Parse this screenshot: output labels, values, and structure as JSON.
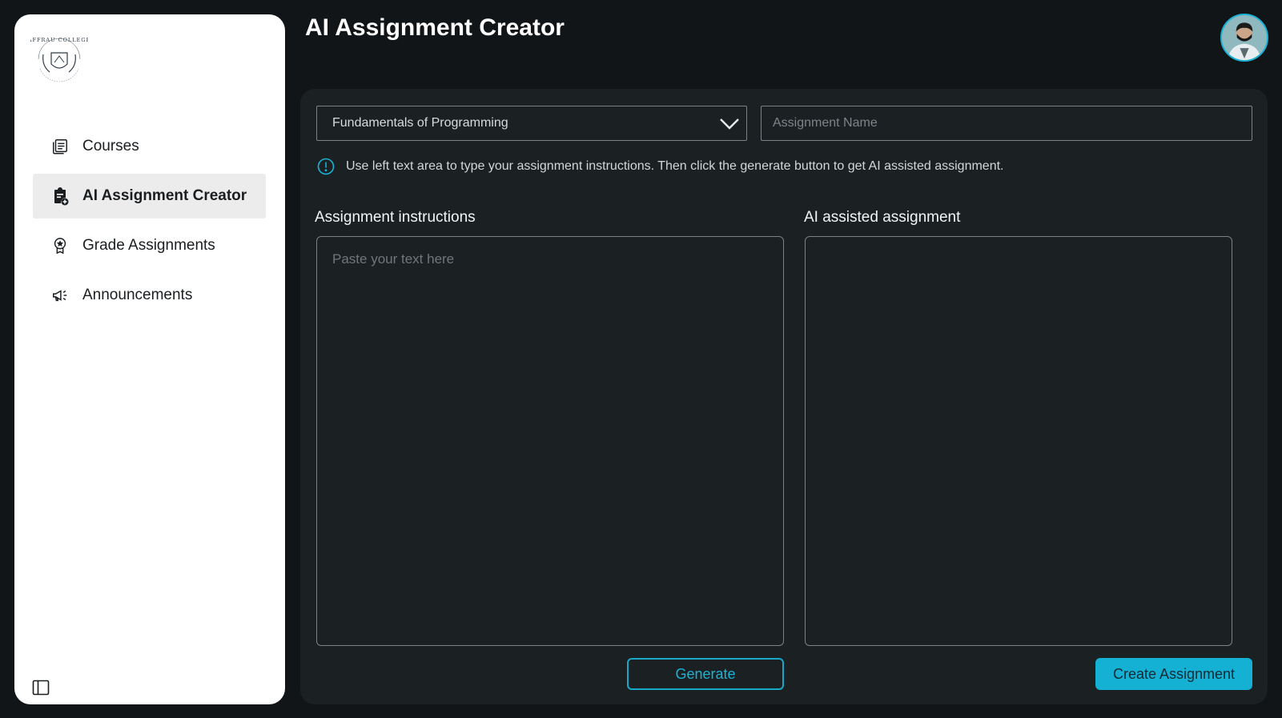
{
  "app": {
    "page_title": "AI Assignment Creator",
    "logo_text": "AFFRAU COLLEGE"
  },
  "sidebar": {
    "items": [
      {
        "label": "Courses",
        "icon": "courses-icon",
        "active": false
      },
      {
        "label": "AI Assignment Creator",
        "icon": "clipboard-plus-icon",
        "active": true
      },
      {
        "label": "Grade Assignments",
        "icon": "award-badge-icon",
        "active": false
      },
      {
        "label": "Announcements",
        "icon": "megaphone-icon",
        "active": false
      }
    ]
  },
  "form": {
    "course_selected": "Fundamentals of Programming",
    "assignment_name_placeholder": "Assignment Name",
    "hint": "Use left text area to type your assignment instructions. Then click the generate button to get AI assisted assignment.",
    "instructions_label": "Assignment instructions",
    "instructions_placeholder": "Paste your text here",
    "ai_label": "AI assisted assignment",
    "ai_output": "",
    "generate_label": "Generate",
    "create_label": "Create Assignment"
  },
  "colors": {
    "accent": "#14b1d4",
    "background": "#111517",
    "panel": "#1b2022",
    "sidebar": "#ffffff"
  }
}
